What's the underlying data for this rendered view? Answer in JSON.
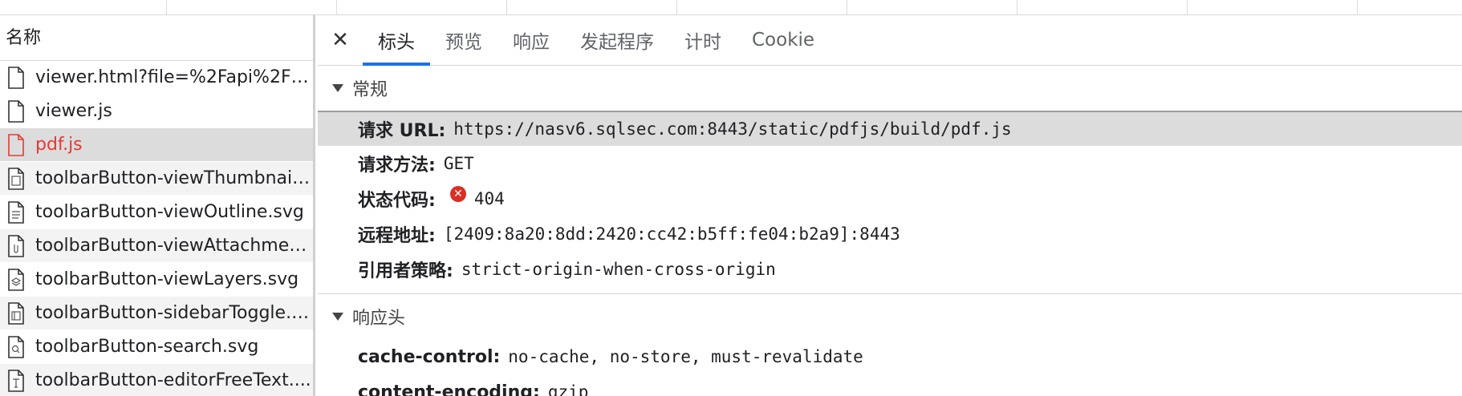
{
  "left_panel": {
    "header": "名称",
    "requests": [
      {
        "name": "viewer.html?file=%2Fapi%2Fb...",
        "icon": "document-icon"
      },
      {
        "name": "viewer.js",
        "icon": "document-icon"
      },
      {
        "name": "pdf.js",
        "icon": "document-icon",
        "status": "error"
      },
      {
        "name": "toolbarButton-viewThumbnail....",
        "icon": "svg-file-icon"
      },
      {
        "name": "toolbarButton-viewOutline.svg",
        "icon": "svg-file-icon"
      },
      {
        "name": "toolbarButton-viewAttachmen...",
        "icon": "svg-file-icon"
      },
      {
        "name": "toolbarButton-viewLayers.svg",
        "icon": "svg-file-icon"
      },
      {
        "name": "toolbarButton-sidebarToggle.s...",
        "icon": "svg-file-icon"
      },
      {
        "name": "toolbarButton-search.svg",
        "icon": "svg-file-icon"
      },
      {
        "name": "toolbarButton-editorFreeText....",
        "icon": "svg-file-icon"
      }
    ]
  },
  "tabs": {
    "close_icon": "close-icon",
    "items": [
      "标头",
      "预览",
      "响应",
      "发起程序",
      "计时",
      "Cookie"
    ],
    "active": "标头"
  },
  "general": {
    "title": "常规",
    "request_url_label": "请求 URL:",
    "request_url": "https://nasv6.sqlsec.com:8443/static/pdfjs/build/pdf.js",
    "request_method_label": "请求方法:",
    "request_method": "GET",
    "status_code_label": "状态代码:",
    "status_code": "404",
    "remote_address_label": "远程地址:",
    "remote_address": "[2409:8a20:8dd:2420:cc42:b5ff:fe04:b2a9]:8443",
    "referrer_policy_label": "引用者策略:",
    "referrer_policy": "strict-origin-when-cross-origin"
  },
  "response_headers": {
    "title": "响应头",
    "items": [
      {
        "key": "cache-control:",
        "value": "no-cache, no-store, must-revalidate"
      },
      {
        "key": "content-encoding:",
        "value": "gzip"
      }
    ]
  },
  "colors": {
    "accent": "#1a73e8",
    "error": "#d93025",
    "selected_text": "#e53935"
  }
}
